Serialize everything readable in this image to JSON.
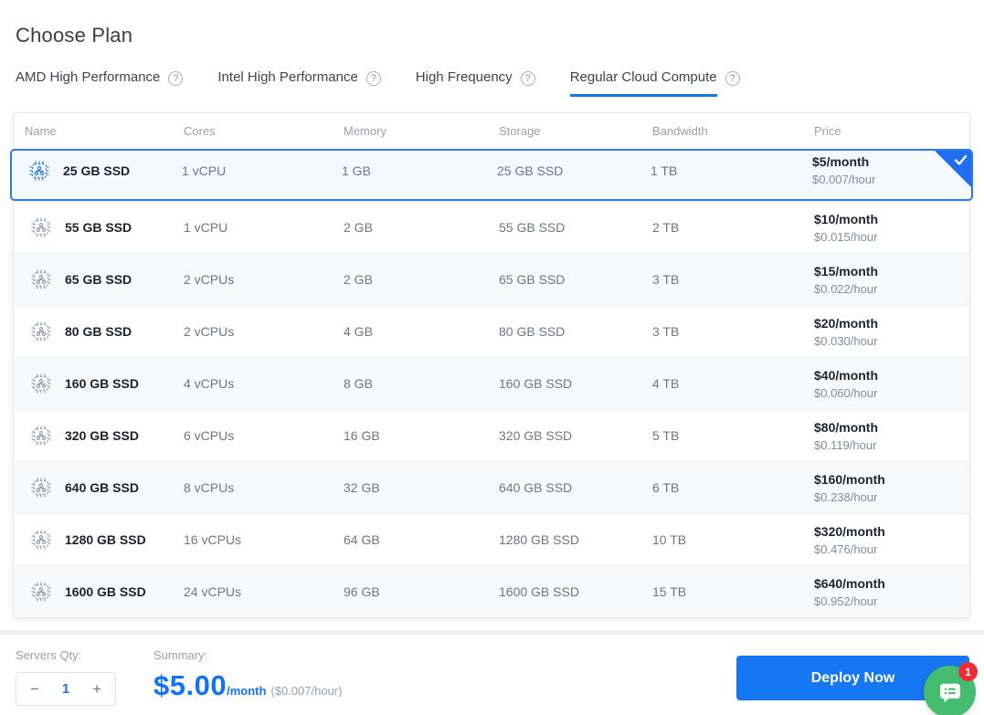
{
  "page": {
    "title": "Choose Plan"
  },
  "tabs": [
    {
      "label": "AMD High Performance",
      "active": false
    },
    {
      "label": "Intel High Performance",
      "active": false
    },
    {
      "label": "High Frequency",
      "active": false
    },
    {
      "label": "Regular Cloud Compute",
      "active": true
    }
  ],
  "help_icon_glyph": "?",
  "table": {
    "columns": [
      "Name",
      "Cores",
      "Memory",
      "Storage",
      "Bandwidth",
      "Price"
    ],
    "rows": [
      {
        "name": "25 GB SSD",
        "cores": "1 vCPU",
        "memory": "1 GB",
        "storage": "25 GB SSD",
        "bandwidth": "1 TB",
        "price_month": "$5/month",
        "price_hour": "$0.007/hour",
        "selected": true
      },
      {
        "name": "55 GB SSD",
        "cores": "1 vCPU",
        "memory": "2 GB",
        "storage": "55 GB SSD",
        "bandwidth": "2 TB",
        "price_month": "$10/month",
        "price_hour": "$0.015/hour",
        "selected": false
      },
      {
        "name": "65 GB SSD",
        "cores": "2 vCPUs",
        "memory": "2 GB",
        "storage": "65 GB SSD",
        "bandwidth": "3 TB",
        "price_month": "$15/month",
        "price_hour": "$0.022/hour",
        "selected": false
      },
      {
        "name": "80 GB SSD",
        "cores": "2 vCPUs",
        "memory": "4 GB",
        "storage": "80 GB SSD",
        "bandwidth": "3 TB",
        "price_month": "$20/month",
        "price_hour": "$0.030/hour",
        "selected": false
      },
      {
        "name": "160 GB SSD",
        "cores": "4 vCPUs",
        "memory": "8 GB",
        "storage": "160 GB SSD",
        "bandwidth": "4 TB",
        "price_month": "$40/month",
        "price_hour": "$0.060/hour",
        "selected": false
      },
      {
        "name": "320 GB SSD",
        "cores": "6 vCPUs",
        "memory": "16 GB",
        "storage": "320 GB SSD",
        "bandwidth": "5 TB",
        "price_month": "$80/month",
        "price_hour": "$0.119/hour",
        "selected": false
      },
      {
        "name": "640 GB SSD",
        "cores": "8 vCPUs",
        "memory": "32 GB",
        "storage": "640 GB SSD",
        "bandwidth": "6 TB",
        "price_month": "$160/month",
        "price_hour": "$0.238/hour",
        "selected": false
      },
      {
        "name": "1280 GB SSD",
        "cores": "16 vCPUs",
        "memory": "64 GB",
        "storage": "1280 GB SSD",
        "bandwidth": "10 TB",
        "price_month": "$320/month",
        "price_hour": "$0.476/hour",
        "selected": false
      },
      {
        "name": "1600 GB SSD",
        "cores": "24 vCPUs",
        "memory": "96 GB",
        "storage": "1600 GB SSD",
        "bandwidth": "15 TB",
        "price_month": "$640/month",
        "price_hour": "$0.952/hour",
        "selected": false
      }
    ]
  },
  "footer": {
    "qty_label": "Servers Qty:",
    "minus_label": "−",
    "qty_value": "1",
    "plus_label": "+",
    "summary_label": "Summary:",
    "summary_price": "$5.00",
    "summary_period": "/month",
    "summary_hour": "($0.007/hour)",
    "deploy_label": "Deploy Now"
  },
  "chat": {
    "badge_count": "1"
  },
  "colors": {
    "accent": "#1a73e8",
    "price_blue": "#1273f2",
    "button_blue": "#1677f2",
    "selected_border": "#2c7cf0",
    "selected_bg": "#f3f9ff",
    "chat_green": "#45bd71",
    "badge_red": "#ee2b38"
  }
}
